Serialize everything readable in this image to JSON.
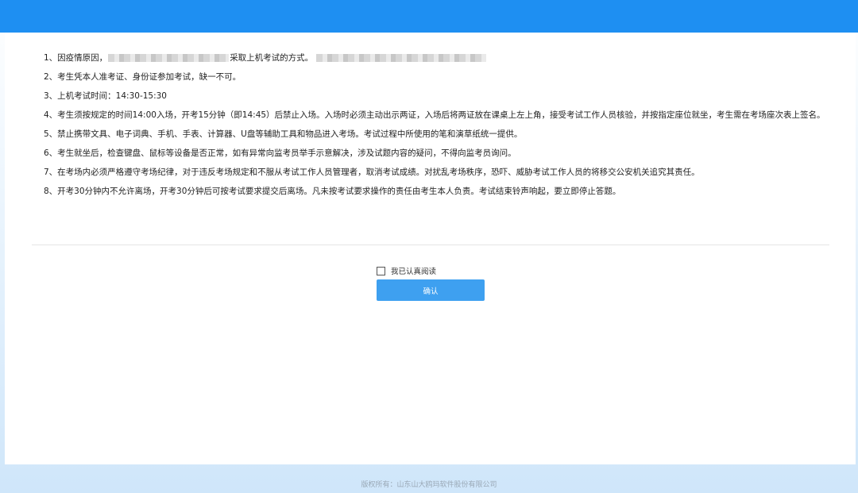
{
  "notice": {
    "items": [
      {
        "before": "1、因疫情原因，",
        "after": "采取上机考试的方式。"
      },
      {
        "text": "2、考生凭本人准考证、身份证参加考试，缺一不可。"
      },
      {
        "text": "3、上机考试时间：14:30-15:30"
      },
      {
        "text": "4、考生须按规定的时间14:00入场，开考15分钟（即14:45）后禁止入场。入场时必须主动出示两证，入场后将两证放在课桌上左上角，接受考试工作人员核验，并按指定座位就坐，考生需在考场座次表上签名。"
      },
      {
        "text": "5、禁止携带文具、电子词典、手机、手表、计算器、U盘等辅助工具和物品进入考场。考试过程中所使用的笔和演草纸统一提供。"
      },
      {
        "text": "6、考生就坐后，检查键盘、鼠标等设备是否正常，如有异常向监考员举手示意解决，涉及试题内容的疑问，不得向监考员询问。"
      },
      {
        "text": "7、在考场内必须严格遵守考场纪律，对于违反考场规定和不服从考试工作人员管理者，取消考试成绩。对扰乱考场秩序，恐吓、威胁考试工作人员的将移交公安机关追究其责任。"
      },
      {
        "text": "8、开考30分钟内不允许离场，开考30分钟后可按考试要求提交后离场。凡未按考试要求操作的责任由考生本人负责。考试结束铃声响起，要立即停止答题。"
      }
    ]
  },
  "agree": {
    "label": "我已认真阅读",
    "checked": false
  },
  "confirm": {
    "label": "确认"
  },
  "footer": {
    "text": "版权所有：山东山大鸥玛软件股份有限公司"
  },
  "colors": {
    "topbar": "#1e8ff2",
    "button": "#3ea0f0",
    "footer_text": "#9aa8b6"
  }
}
